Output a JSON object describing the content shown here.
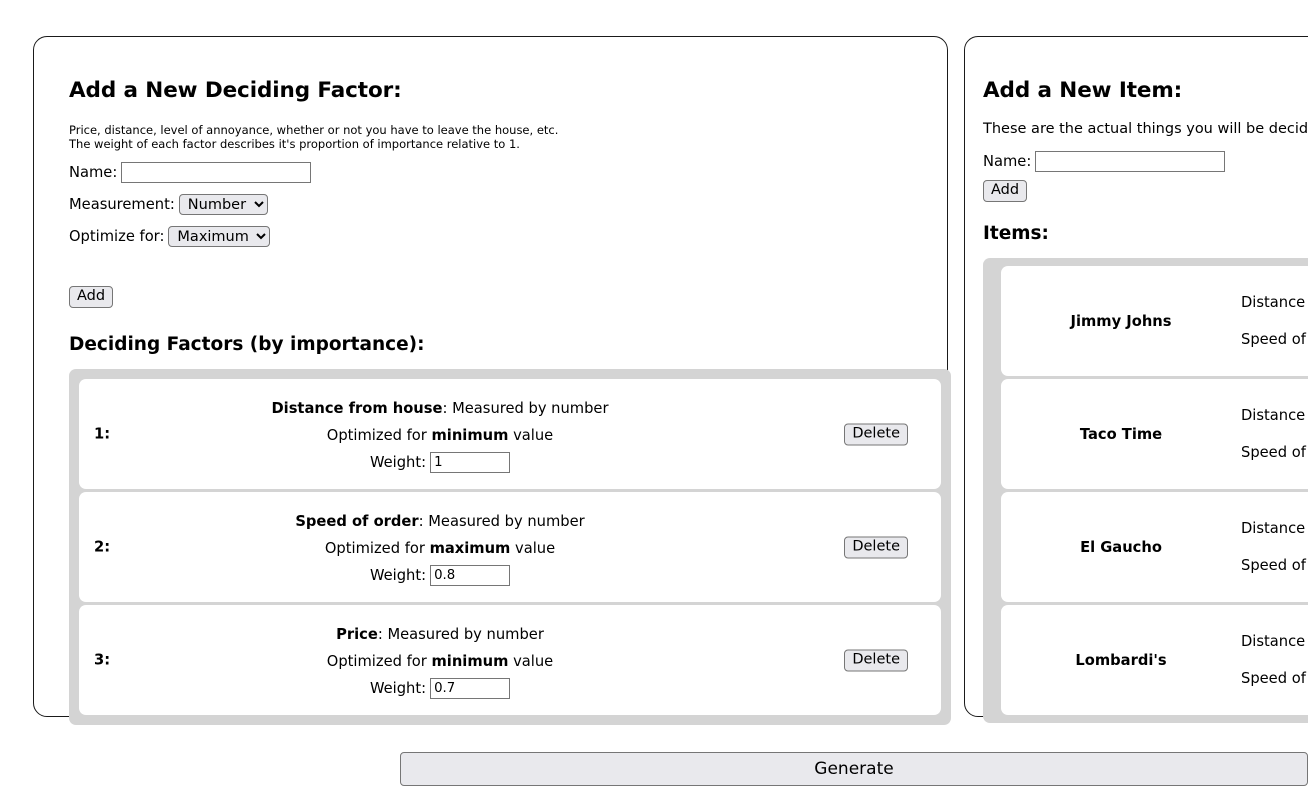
{
  "factor_panel": {
    "title": "Add a New Deciding Factor:",
    "blurb": "Price, distance, level of annoyance, whether or not you have to leave the house, etc.\nThe weight of each factor describes it's proportion of importance relative to 1.",
    "name_label": "Name:",
    "name_value": "",
    "name_placeholder": "",
    "measurement_label": "Measurement:",
    "measurement_value": "Number",
    "measurement_options": [
      "Number"
    ],
    "optimize_label": "Optimize for:",
    "optimize_value": "Maximum",
    "optimize_options": [
      "Maximum"
    ],
    "add_label": "Add",
    "list_title": "Deciding Factors (by importance):",
    "weight_label": "Weight:",
    "delete_label": "Delete",
    "factors": [
      {
        "index": "1:",
        "name": "Distance from house",
        "measured_by": ": Measured by number",
        "optimized_prefix": "Optimized for ",
        "optimized_value": "minimum",
        "optimized_suffix": " value",
        "weight": "1"
      },
      {
        "index": "2:",
        "name": "Speed of order",
        "measured_by": ": Measured by number",
        "optimized_prefix": "Optimized for ",
        "optimized_value": "maximum",
        "optimized_suffix": " value",
        "weight": "0.8"
      },
      {
        "index": "3:",
        "name": "Price",
        "measured_by": ": Measured by number",
        "optimized_prefix": "Optimized for ",
        "optimized_value": "minimum",
        "optimized_suffix": " value",
        "weight": "0.7"
      }
    ]
  },
  "item_panel": {
    "title": "Add a New Item:",
    "blurb": "These are the actual things you will be deciding between.",
    "name_label": "Name:",
    "name_value": "",
    "name_placeholder": "",
    "add_label": "Add",
    "list_title": "Items:",
    "items": [
      {
        "name": "Jimmy Johns",
        "factors": [
          "Distance from house:",
          "Speed of order:"
        ]
      },
      {
        "name": "Taco Time",
        "factors": [
          "Distance from house:",
          "Speed of order:"
        ]
      },
      {
        "name": "El Gaucho",
        "factors": [
          "Distance from house:",
          "Speed of order:"
        ]
      },
      {
        "name": "Lombardi's",
        "factors": [
          "Distance from house:",
          "Speed of order:"
        ]
      }
    ]
  },
  "footer": {
    "generate_label": "Generate"
  },
  "colors": {
    "panel_border": "#1a1a1a",
    "list_background": "#d4d4d4",
    "card_background": "#ffffff",
    "control_background": "#e9e9ed",
    "control_border": "#767676"
  }
}
